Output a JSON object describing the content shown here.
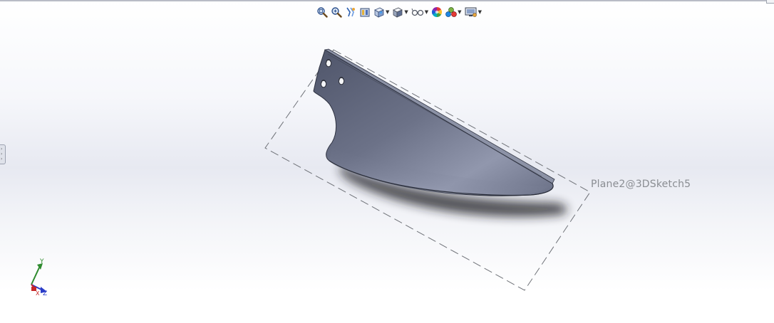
{
  "viewport": {
    "background_top": "#ffffff",
    "background_mid": "#e7e9f1"
  },
  "heads_up_toolbar": {
    "buttons": [
      {
        "name": "zoom-to-fit-icon",
        "has_dropdown": false
      },
      {
        "name": "zoom-to-area-icon",
        "has_dropdown": false
      },
      {
        "name": "previous-view-icon",
        "has_dropdown": false
      },
      {
        "name": "section-view-icon",
        "has_dropdown": false
      },
      {
        "name": "view-orientation-icon",
        "has_dropdown": true
      },
      {
        "name": "display-style-icon",
        "has_dropdown": true
      },
      {
        "name": "hide-show-items-icon",
        "has_dropdown": true
      },
      {
        "name": "edit-appearance-icon",
        "has_dropdown": false
      },
      {
        "name": "apply-scene-icon",
        "has_dropdown": true
      },
      {
        "name": "view-settings-icon",
        "has_dropdown": true
      }
    ],
    "dropdown_glyph": "▼"
  },
  "model": {
    "plane_label": "Plane2@3DSketch5",
    "part_color": "#6c7288",
    "part_edge_color": "#2e3240"
  },
  "triad": {
    "y_label": "Y",
    "x_label": "X",
    "z_label": "Z",
    "y_color": "#2e8b2e",
    "x_color": "#c62828",
    "z_color": "#2a3cc8"
  },
  "left_panel_handle": {
    "glyph": "›"
  }
}
